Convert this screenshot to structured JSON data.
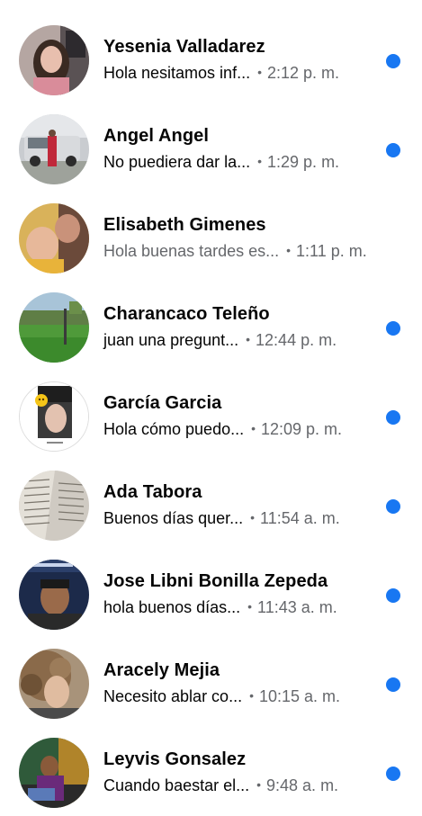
{
  "colors": {
    "unread_dot": "#1877f2",
    "name_text": "#050505",
    "secondary_text": "#65676b"
  },
  "separator": "•",
  "conversations": [
    {
      "name": "Yesenia Valladarez",
      "preview": "Hola nesitamos inf...",
      "time": "2:12 p. m.",
      "unread": true,
      "avatar": "avatar-photo-woman"
    },
    {
      "name": "Angel Angel",
      "preview": "No puediera dar la...",
      "time": "1:29 p. m.",
      "unread": true,
      "avatar": "avatar-photo-truck"
    },
    {
      "name": "Elisabeth Gimenes",
      "preview": "Hola buenas tardes es...",
      "time": "1:11 p. m.",
      "unread": false,
      "avatar": "avatar-photo-selfie"
    },
    {
      "name": "Charancaco Teleño",
      "preview": "juan una pregunt...",
      "time": "12:44 p. m.",
      "unread": true,
      "avatar": "avatar-photo-field"
    },
    {
      "name": "García Garcia",
      "preview": "Hola cómo puedo...",
      "time": "12:09 p. m.",
      "unread": true,
      "avatar": "avatar-photo-sticker"
    },
    {
      "name": "Ada Tabora",
      "preview": "Buenos días  quer...",
      "time": "11:54 a. m.",
      "unread": true,
      "avatar": "avatar-photo-book"
    },
    {
      "name": "Jose Libni Bonilla Zepeda",
      "preview": "hola buenos días...",
      "time": "11:43 a. m.",
      "unread": true,
      "avatar": "avatar-photo-car-selfie"
    },
    {
      "name": "Aracely Mejia",
      "preview": "Necesito ablar co...",
      "time": "10:15 a. m.",
      "unread": true,
      "avatar": "avatar-photo-curly-hair"
    },
    {
      "name": "Leyvis Gonsalez",
      "preview": "Cuando baestar el...",
      "time": "9:48 a. m.",
      "unread": true,
      "avatar": "avatar-photo-person-sitting"
    }
  ]
}
